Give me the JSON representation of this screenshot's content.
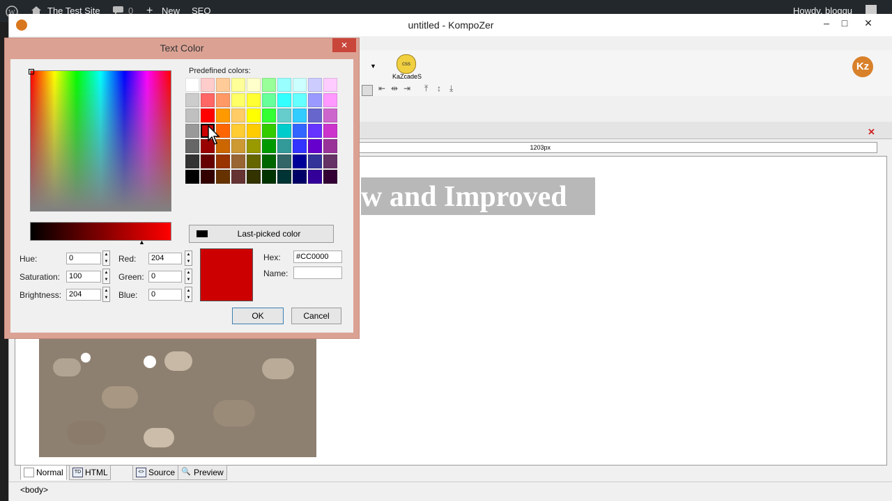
{
  "wp_admin_bar": {
    "site_name": "The Test Site",
    "comments_count": "0",
    "new_label": "New",
    "seo_label": "SEO",
    "howdy": "Howdy, bloggu"
  },
  "app": {
    "window_title": "untitled - KompoZer"
  },
  "toolbar": {
    "kazcades_label": "KaZcadeS",
    "ruler_text": "1203px"
  },
  "document": {
    "heading_text": "w and Improved"
  },
  "bottom_tabs": [
    {
      "label": "Normal"
    },
    {
      "label": "HTML Tags"
    },
    {
      "label": "Source"
    },
    {
      "label": "Preview"
    }
  ],
  "status": {
    "tag_path": "<body>"
  },
  "dialog": {
    "title": "Text Color",
    "predefined_label": "Predefined colors:",
    "last_picked_label": "Last-picked color",
    "hue_label": "Hue:",
    "hue_value": "0",
    "saturation_label": "Saturation:",
    "saturation_value": "100",
    "brightness_label": "Brightness:",
    "brightness_value": "204",
    "red_label": "Red:",
    "red_value": "204",
    "green_label": "Green:",
    "green_value": "0",
    "blue_label": "Blue:",
    "blue_value": "0",
    "hex_label": "Hex:",
    "hex_value": "#CC0000",
    "name_label": "Name:",
    "name_value": "",
    "ok_label": "OK",
    "cancel_label": "Cancel",
    "current_color": "#cc0000",
    "last_picked_color": "#000000",
    "palette": [
      [
        "#ffffff",
        "#ffcccc",
        "#ffcc99",
        "#ffff99",
        "#ffffcc",
        "#99ff99",
        "#99ffff",
        "#ccffff",
        "#ccccff",
        "#ffccff"
      ],
      [
        "#cccccc",
        "#ff6666",
        "#ff9966",
        "#ffff66",
        "#ffff33",
        "#66ff99",
        "#33ffff",
        "#66ffff",
        "#9999ff",
        "#ff99ff"
      ],
      [
        "#c0c0c0",
        "#ff0000",
        "#ff9900",
        "#ffcc66",
        "#ffff00",
        "#33ff33",
        "#66cccc",
        "#33ccff",
        "#6666cc",
        "#cc66cc"
      ],
      [
        "#999999",
        "#cc0000",
        "#ff6600",
        "#ffcc33",
        "#ffcc00",
        "#33cc00",
        "#00cccc",
        "#3366ff",
        "#6633ff",
        "#cc33cc"
      ],
      [
        "#666666",
        "#990000",
        "#cc6600",
        "#cc9933",
        "#999900",
        "#009900",
        "#339999",
        "#3333ff",
        "#6600cc",
        "#993399"
      ],
      [
        "#333333",
        "#660000",
        "#993300",
        "#996633",
        "#666600",
        "#006600",
        "#336666",
        "#000099",
        "#333399",
        "#663366"
      ],
      [
        "#000000",
        "#330000",
        "#663300",
        "#663333",
        "#333300",
        "#003300",
        "#003333",
        "#000066",
        "#330099",
        "#330033"
      ]
    ]
  }
}
